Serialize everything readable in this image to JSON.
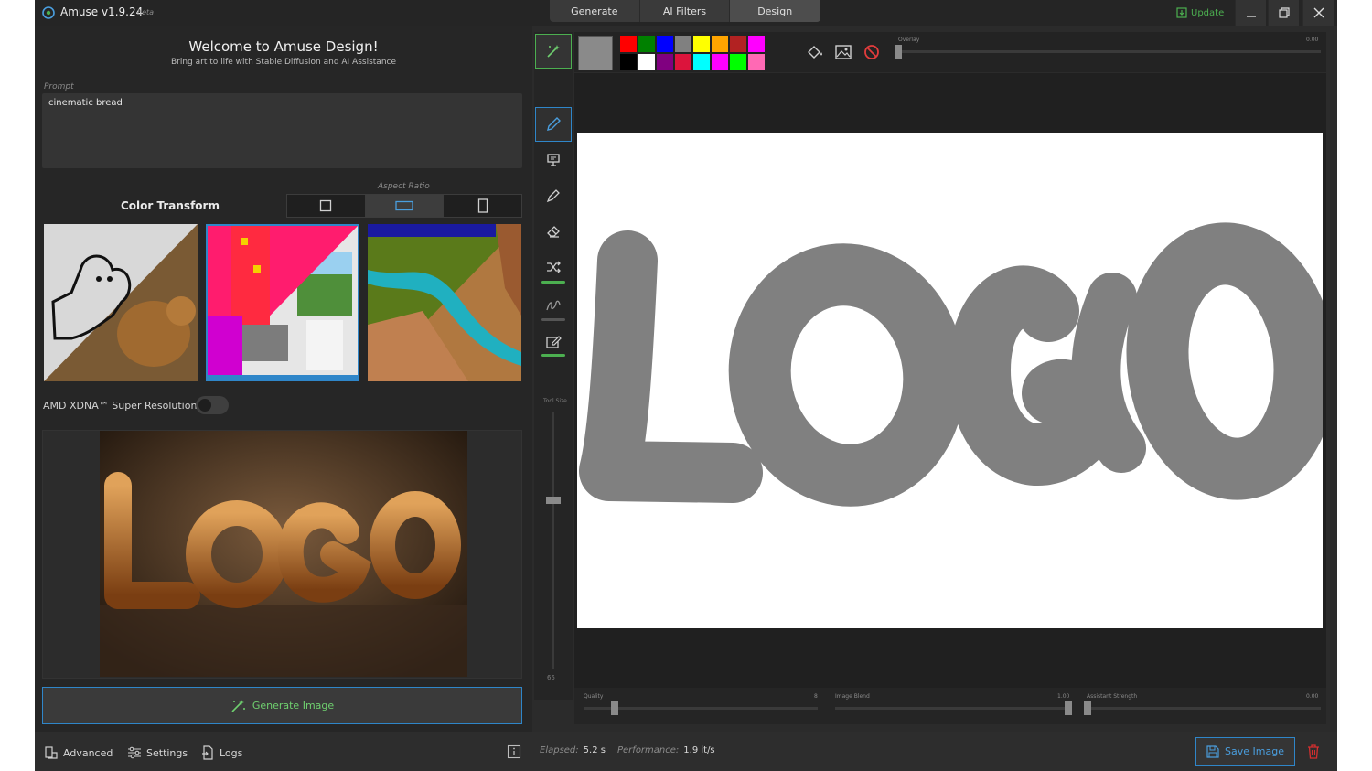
{
  "window": {
    "title": "Amuse v1.9.24",
    "version_tag": "beta",
    "update_label": "Update"
  },
  "mode_tabs": [
    {
      "label": "Generate",
      "active": false
    },
    {
      "label": "AI Filters",
      "active": false
    },
    {
      "label": "Design",
      "active": true
    }
  ],
  "left": {
    "welcome_title": "Welcome to Amuse Design!",
    "welcome_subtitle": "Bring art to life with Stable Diffusion and AI Assistance",
    "prompt_label": "Prompt",
    "prompt_value": "cinematic bread",
    "aspect_ratio_label": "Aspect Ratio",
    "aspect_selected": "landscape",
    "color_transform_label": "Color Transform",
    "super_resolution_label": "AMD XDNA™ Super Resolution",
    "super_resolution_on": false,
    "generate_label": "Generate Image",
    "selected_thumbnail": 2
  },
  "tools": {
    "tool_size_label": "Tool Size",
    "tool_size_min": "65",
    "tool_size_level": 0.4
  },
  "palette": {
    "current_color": "#8a8a8a",
    "swatches_row1": [
      "#ff0000",
      "#008000",
      "#0000ff",
      "#808080",
      "#ffff00",
      "#ffa500",
      "#b22222",
      "#ff00ff"
    ],
    "swatches_row2": [
      "#000000",
      "#ffffff",
      "#800080",
      "#dc143c",
      "#00ffff",
      "#ff00ff",
      "#00ff00",
      "#ff69b4"
    ],
    "overlay_label": "Overlay",
    "overlay_value": "0.00"
  },
  "canvas": {
    "drawn_text": "LOGO",
    "stroke_color": "#808080"
  },
  "bottom": {
    "quality_label": "Quality",
    "quality_value": "8",
    "image_blend_label": "Image Blend",
    "image_blend_value": "1.00",
    "assistant_strength_label": "Assistant Strength",
    "assistant_strength_value": "0.00"
  },
  "status": {
    "advanced_label": "Advanced",
    "settings_label": "Settings",
    "logs_label": "Logs",
    "elapsed_label": "Elapsed:",
    "elapsed_value": "5.2 s",
    "performance_label": "Performance:",
    "performance_value": "1.9 it/s",
    "save_label": "Save Image"
  },
  "colors": {
    "accent_blue": "#2f86c9",
    "accent_green": "#4caf50",
    "danger_red": "#d32f2f"
  }
}
